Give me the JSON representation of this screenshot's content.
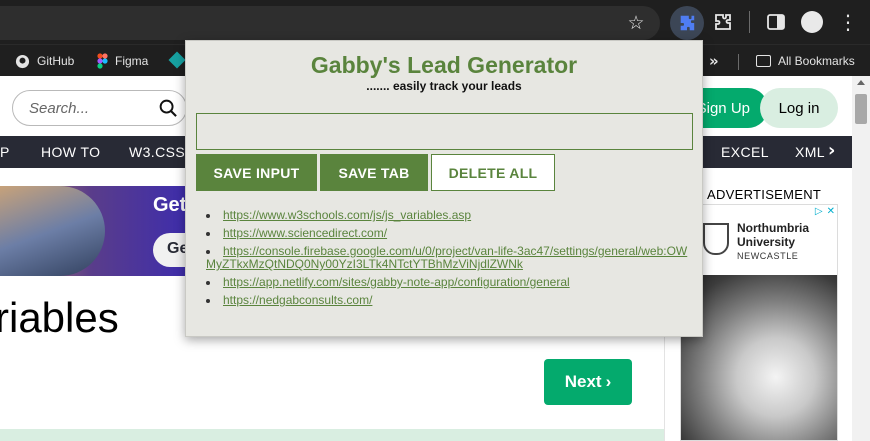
{
  "browser": {
    "bookmarks": {
      "items": [
        {
          "label": "GitHub",
          "icon": "github-icon"
        },
        {
          "label": "Figma",
          "icon": "figma-icon"
        }
      ],
      "overflow_label": "»",
      "all_bookmarks_label": "All Bookmarks"
    }
  },
  "page": {
    "search_placeholder": "Search...",
    "signup_label": "Sign Up",
    "login_label": "Log in",
    "nav": [
      "P",
      "HOW TO",
      "W3.CSS",
      "EXCEL",
      "XML"
    ],
    "banner_text": "Get",
    "banner_button": "Ge",
    "heading": "riables",
    "next_label": "Next",
    "ad_label": "ADVERTISEMENT",
    "ad_university": "Northumbria University",
    "ad_city": "NEWCASTLE",
    "accent_color": "#04aa6d",
    "nav_bg_color": "#282a35"
  },
  "extension": {
    "title": "Gabby's Lead Generator",
    "subtitle": "....... easily track your leads",
    "input_value": "",
    "buttons": {
      "save_input": "SAVE INPUT",
      "save_tab": "SAVE TAB",
      "delete_all": "DELETE ALL"
    },
    "leads": [
      "https://www.w3schools.com/js/js_variables.asp",
      "https://www.sciencedirect.com/",
      "https://console.firebase.google.com/u/0/project/van-life-3ac47/settings/general/web:OWMyZTkxMzQtNDQ0Ny00YzI3LTk4NTctYTBhMzViNjdlZWNk",
      "https://app.netlify.com/sites/gabby-note-app/configuration/general",
      "https://nedgabconsults.com/"
    ],
    "accent_color": "#5a843d",
    "background_color": "#e7e7e2"
  }
}
